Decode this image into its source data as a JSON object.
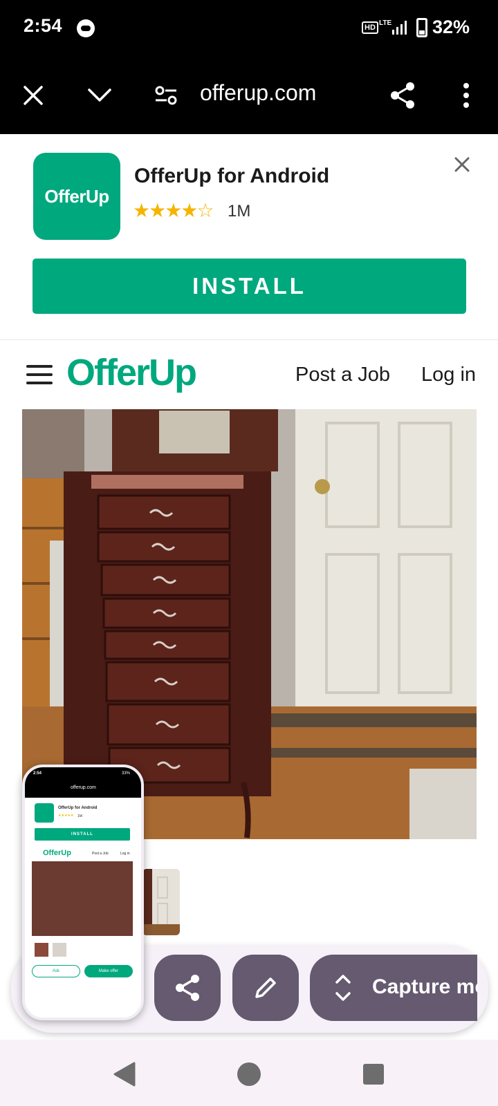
{
  "status_bar": {
    "time": "2:54",
    "hd": "HD",
    "network": "LTE",
    "battery": "32%",
    "icons": [
      "game-controller-icon",
      "signal-icon",
      "battery-icon"
    ]
  },
  "browser": {
    "url": "offerup.com",
    "icons": [
      "close-icon",
      "chevron-down-icon",
      "site-settings-icon",
      "share-icon",
      "more-vert-icon"
    ]
  },
  "banner": {
    "app_name": "OfferUp for Android",
    "icon_text": "OfferUp",
    "rating_stars": "★★★★☆",
    "rating": 4.5,
    "downloads": "1M",
    "install_label": "INSTALL"
  },
  "site": {
    "logo": "OfferUp",
    "nav": {
      "post_job": "Post a Job",
      "login": "Log in"
    }
  },
  "capture_toolbar": {
    "capture_more_label": "Capture more",
    "buttons": [
      "share-icon",
      "edit-icon",
      "expand-icon"
    ]
  },
  "preview": {
    "time": "2:54",
    "battery": "33%",
    "url": "offerup.com",
    "app_name": "OfferUp for Android",
    "stars": "★★★★★",
    "downloads": "1M",
    "install": "INSTALL",
    "logo": "OfferUp",
    "post_job": "Post a Job",
    "login": "Log in",
    "ask": "Ask",
    "make_offer": "Make offer"
  },
  "colors": {
    "brand": "#00a87e",
    "toolbar_button": "#655a70",
    "star": "#f5b400"
  }
}
